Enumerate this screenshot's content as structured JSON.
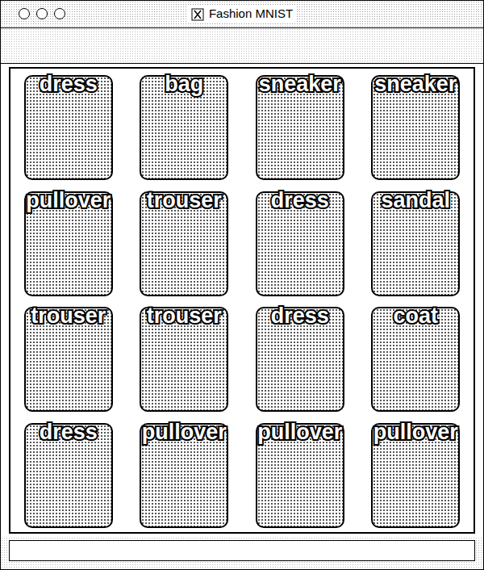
{
  "window": {
    "title": "Fashion MNIST"
  },
  "grid": {
    "items": [
      {
        "label": "dress"
      },
      {
        "label": "bag"
      },
      {
        "label": "sneaker"
      },
      {
        "label": "sneaker"
      },
      {
        "label": "pullover"
      },
      {
        "label": "trouser"
      },
      {
        "label": "dress"
      },
      {
        "label": "sandal"
      },
      {
        "label": "trouser"
      },
      {
        "label": "trouser"
      },
      {
        "label": "dress"
      },
      {
        "label": "coat"
      },
      {
        "label": "dress"
      },
      {
        "label": "pullover"
      },
      {
        "label": "pullover"
      },
      {
        "label": "pullover"
      }
    ]
  }
}
